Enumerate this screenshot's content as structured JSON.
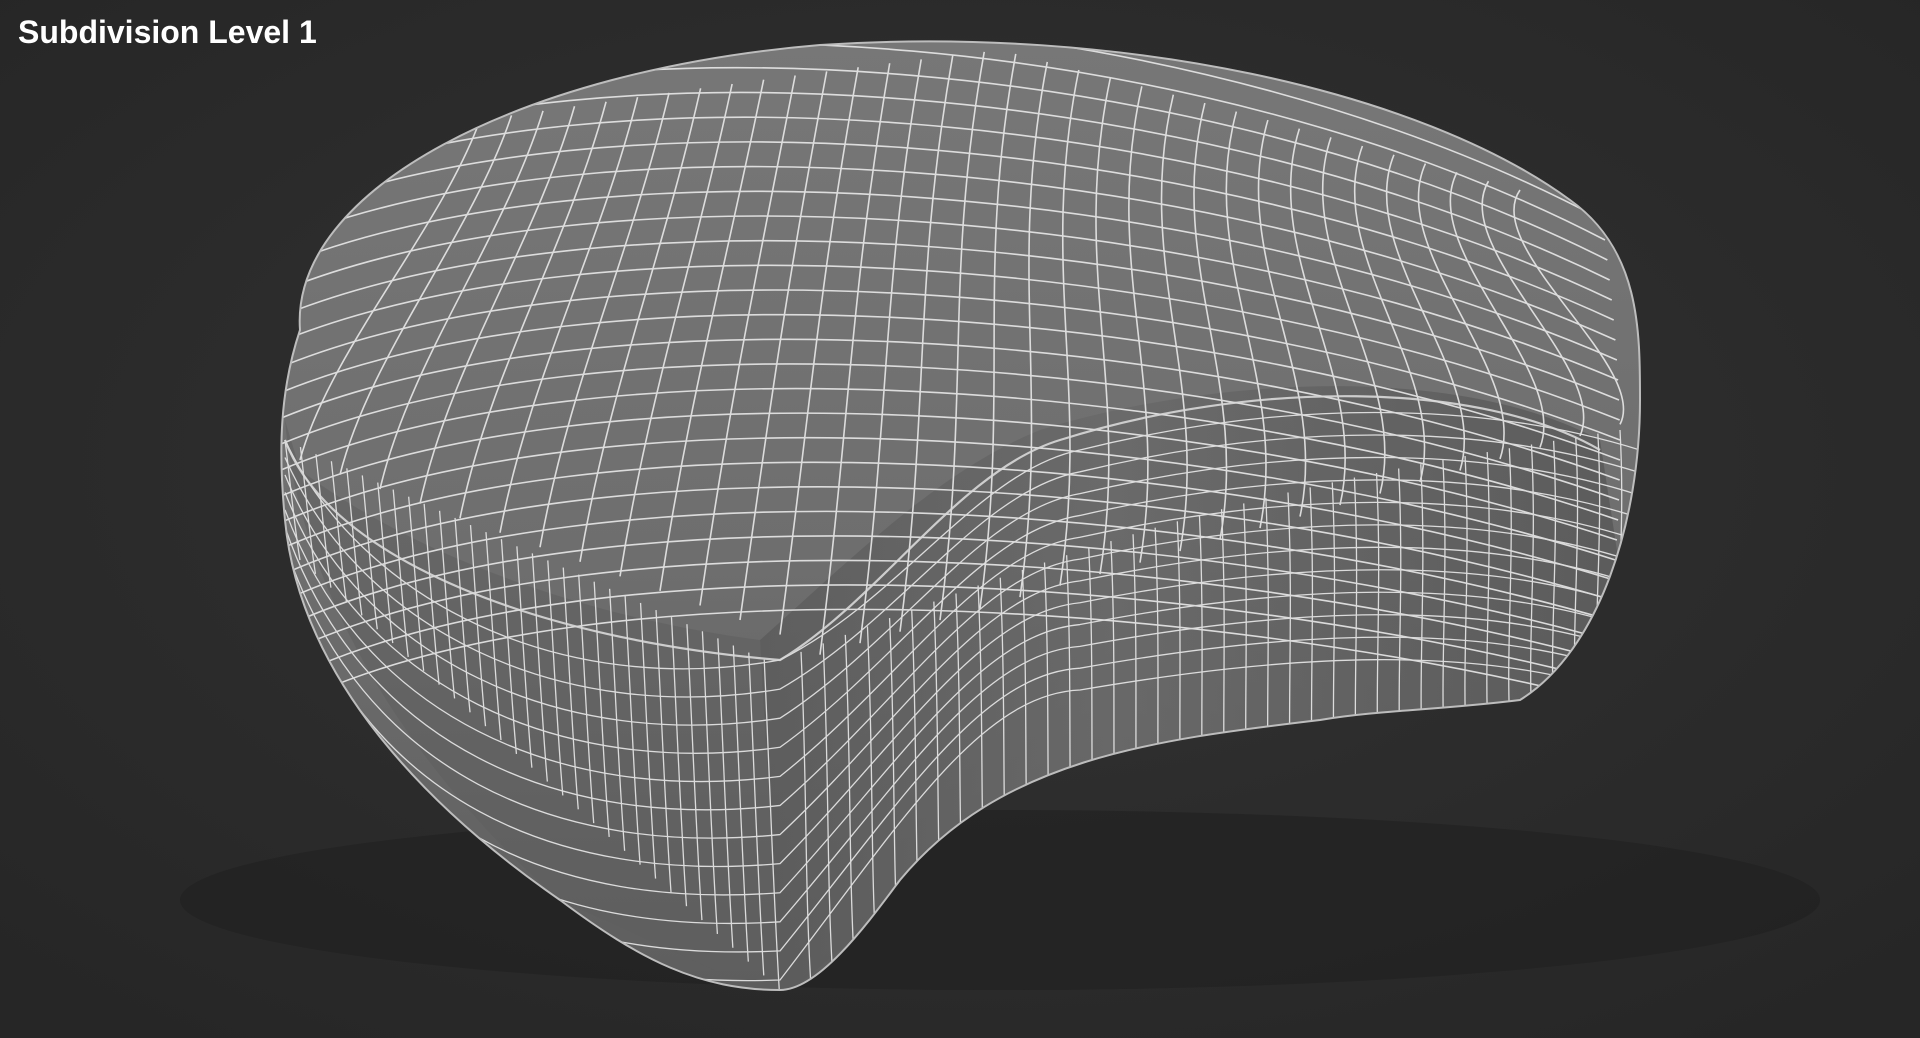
{
  "render": {
    "label": "Subdivision Level 1",
    "background_color": "#2b2b2b",
    "mesh_fill_color": "#6e6e6e",
    "wire_color": "#e6e6e6",
    "label_color": "#ffffff",
    "model_icon": "wireframe-mesh"
  }
}
